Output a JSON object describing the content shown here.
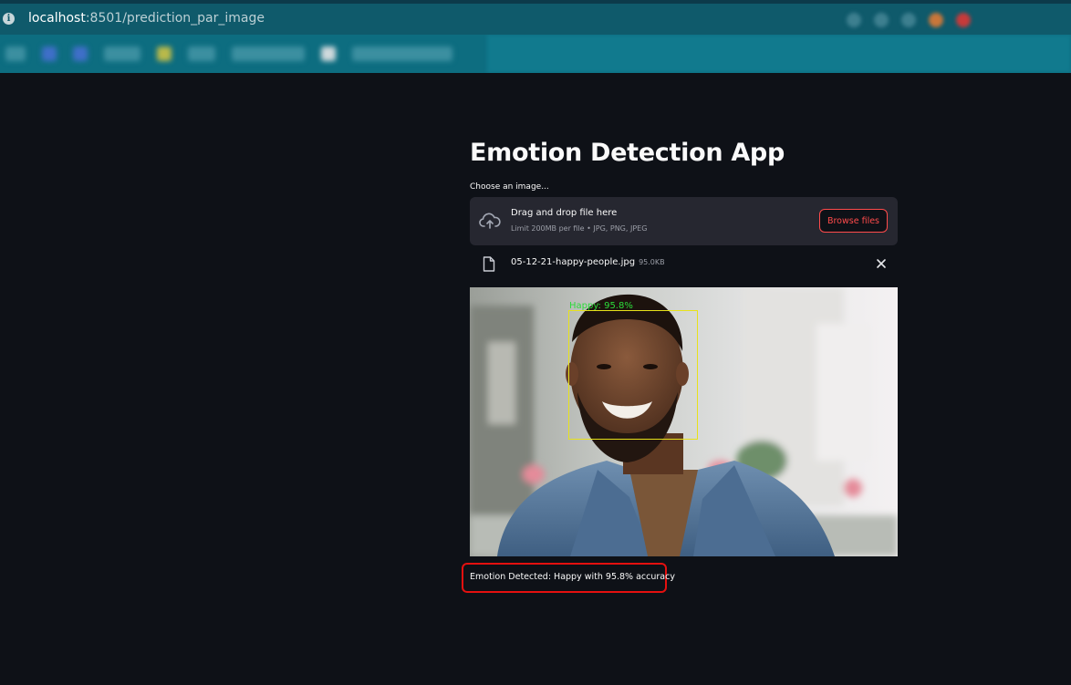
{
  "browser": {
    "url_host": "localhost",
    "url_path": ":8501/prediction_par_image"
  },
  "app": {
    "title": "Emotion Detection App",
    "uploader_label": "Choose an image...",
    "dropzone": {
      "title": "Drag and drop file here",
      "limit": "Limit 200MB per file • JPG, PNG, JPEG",
      "browse_label": "Browse files"
    },
    "uploaded_file": {
      "name": "05-12-21-happy-people.jpg",
      "size": "95.0KB"
    },
    "detection": {
      "box_label": "Happy: 95.8%",
      "box_color": "#e8e21a",
      "label_color": "#2bdc3a"
    },
    "result_text": "Emotion Detected: Happy with 95.8% accuracy"
  },
  "colors": {
    "background": "#0e1117",
    "accent": "#ff4b4b",
    "result_border": "#e4100f"
  }
}
